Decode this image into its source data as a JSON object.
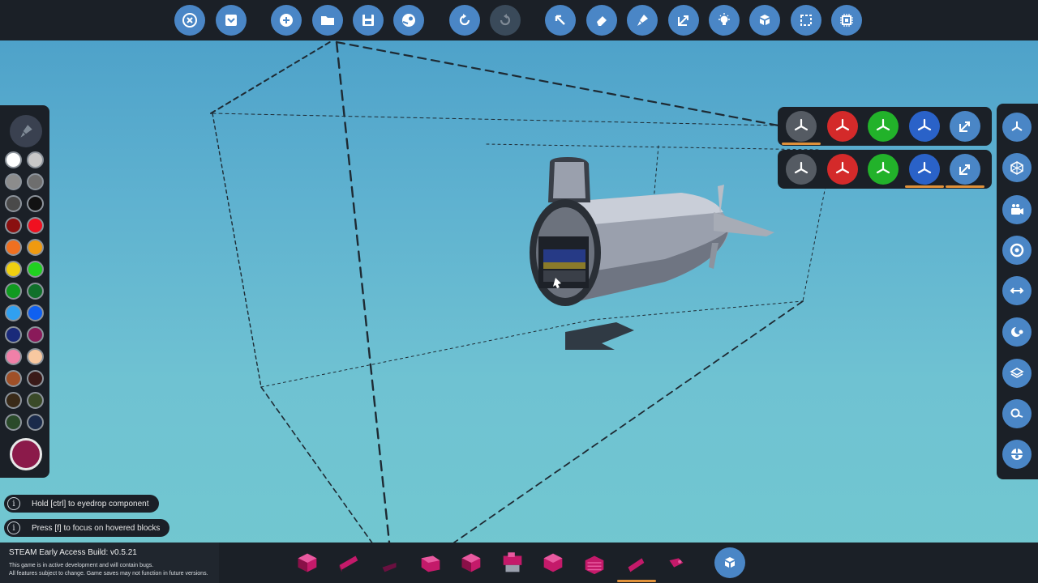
{
  "toolbar": {
    "buttons": [
      {
        "name": "close-icon"
      },
      {
        "name": "dropdown-icon"
      },
      {
        "name": "add-icon"
      },
      {
        "name": "folder-icon"
      },
      {
        "name": "save-icon"
      },
      {
        "name": "steam-icon"
      },
      {
        "name": "undo-icon"
      },
      {
        "name": "redo-icon"
      },
      {
        "name": "cursor-icon"
      },
      {
        "name": "eraser-icon"
      },
      {
        "name": "paint-icon"
      },
      {
        "name": "resize-icon"
      },
      {
        "name": "light-icon"
      },
      {
        "name": "blocks-icon"
      },
      {
        "name": "select-icon"
      },
      {
        "name": "chip-icon"
      }
    ]
  },
  "palette": {
    "colors": [
      "#ffffff",
      "#c8c8c8",
      "#8c8c8c",
      "#6e6e6e",
      "#4a4a4a",
      "#121212",
      "#8a1010",
      "#f01020",
      "#f07020",
      "#f09a10",
      "#f0d010",
      "#20d020",
      "#109a20",
      "#10702a",
      "#30a0f0",
      "#1060f0",
      "#1a2a7a",
      "#8a1a5a",
      "#f080a8",
      "#f8c8a0",
      "#a05028",
      "#3a1a18",
      "#3a2a18",
      "#3a4a28",
      "#2a4a2a",
      "#1a2a4a"
    ],
    "current_color": "#8b1a4a"
  },
  "axis_panels": {
    "rotate": [
      {
        "name": "axis-neutral-icon",
        "color": "#555b63"
      },
      {
        "name": "axis-x-icon",
        "color": "#d42a2a"
      },
      {
        "name": "axis-y-icon",
        "color": "#22b22a"
      },
      {
        "name": "axis-z-icon",
        "color": "#2a62c8"
      },
      {
        "name": "scale-icon",
        "color": "#4a86c6"
      }
    ],
    "translate": [
      {
        "name": "axis-neutral-icon",
        "color": "#555b63"
      },
      {
        "name": "axis-x-icon",
        "color": "#d42a2a"
      },
      {
        "name": "axis-y-icon",
        "color": "#22b22a"
      },
      {
        "name": "axis-z-icon",
        "color": "#2a62c8"
      },
      {
        "name": "scale-icon",
        "color": "#4a86c6"
      }
    ]
  },
  "right_panel": {
    "buttons": [
      {
        "name": "axis-view-icon"
      },
      {
        "name": "cube-view-icon"
      },
      {
        "name": "camera-icon"
      },
      {
        "name": "target-icon"
      },
      {
        "name": "arrows-icon"
      },
      {
        "name": "moon-icon"
      },
      {
        "name": "layer-icon"
      },
      {
        "name": "search-icon"
      },
      {
        "name": "globe-icon"
      }
    ]
  },
  "hints": {
    "eyedrop": "Hold [ctrl] to eyedrop component",
    "focus": "Press [f] to focus on hovered blocks",
    "info_glyph": "i"
  },
  "build_info": {
    "title": "STEAM Early Access Build: v0.5.21",
    "note_1": "This game is in active development and will contain bugs.",
    "note_2": "All features subject to change. Game saves may not function in future versions."
  },
  "inventory": {
    "accent": "#c41a6a",
    "active_index": 8
  }
}
